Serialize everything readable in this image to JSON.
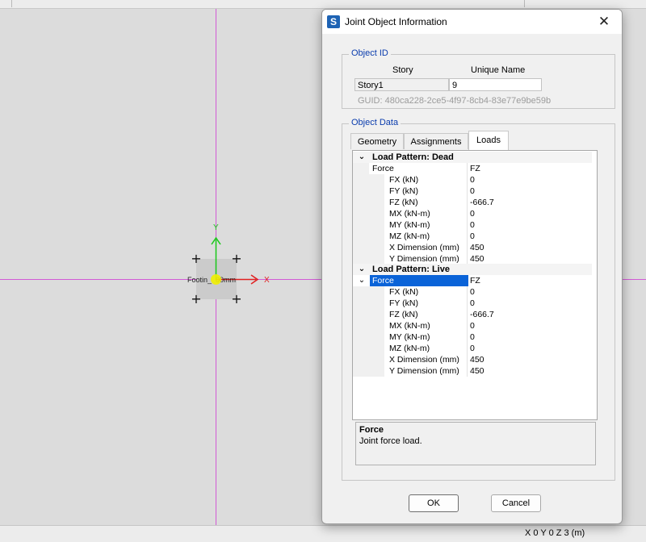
{
  "status": {
    "coords": "X 0  Y 0  Z 3 (m)"
  },
  "model": {
    "footing_label": "Footin_  00mm",
    "axis_x": "X",
    "axis_y": "Y",
    "colors": {
      "grid_line": "#d25ad6",
      "x_axis": "#e02020",
      "y_axis": "#19c819",
      "joint_highlight": "#f1f000"
    }
  },
  "dialog": {
    "app_icon": "S",
    "title": "Joint Object Information",
    "close_icon": "close-icon",
    "object_id": {
      "group_title": "Object ID",
      "story_header": "Story",
      "unique_name_header": "Unique Name",
      "story_value": "Story1",
      "unique_name_value": "9",
      "guid": "GUID:  480ca228-2ce5-4f97-8cb4-83e77e9be59b"
    },
    "object_data": {
      "group_title": "Object Data",
      "tabs": [
        {
          "label": "Geometry",
          "active": false
        },
        {
          "label": "Assignments",
          "active": false
        },
        {
          "label": "Loads",
          "active": true
        }
      ],
      "sections": [
        {
          "title": "Load Pattern: Dead",
          "force_label": "Force",
          "force_value": "FZ",
          "rows": [
            {
              "name": "FX (kN)",
              "value": "0"
            },
            {
              "name": "FY (kN)",
              "value": "0"
            },
            {
              "name": "FZ (kN)",
              "value": "-666.7"
            },
            {
              "name": "MX (kN-m)",
              "value": "0"
            },
            {
              "name": "MY (kN-m)",
              "value": "0"
            },
            {
              "name": "MZ (kN-m)",
              "value": "0"
            },
            {
              "name": "X Dimension (mm)",
              "value": "450"
            },
            {
              "name": "Y Dimension (mm)",
              "value": "450"
            }
          ]
        },
        {
          "title": "Load Pattern: Live",
          "force_label": "Force",
          "force_value": "FZ",
          "rows": [
            {
              "name": "FX (kN)",
              "value": "0"
            },
            {
              "name": "FY (kN)",
              "value": "0"
            },
            {
              "name": "FZ (kN)",
              "value": "-666.7"
            },
            {
              "name": "MX (kN-m)",
              "value": "0"
            },
            {
              "name": "MY (kN-m)",
              "value": "0"
            },
            {
              "name": "MZ (kN-m)",
              "value": "0"
            },
            {
              "name": "X Dimension (mm)",
              "value": "450"
            },
            {
              "name": "Y Dimension (mm)",
              "value": "450"
            }
          ]
        }
      ],
      "description": {
        "title": "Force",
        "text": "Joint force load."
      }
    },
    "buttons": {
      "ok": "OK",
      "cancel": "Cancel"
    }
  }
}
